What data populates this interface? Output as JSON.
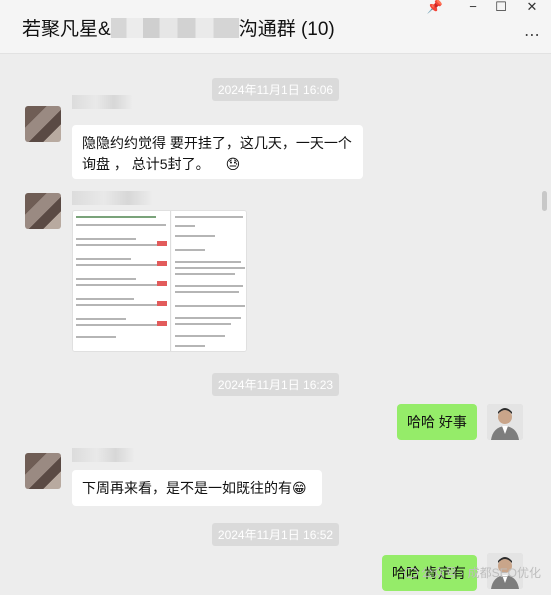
{
  "window": {
    "title_prefix": "若聚凡星&",
    "title_suffix": "沟通群 (10)",
    "pin_icon": "📌",
    "minimize_icon": "−",
    "maximize_icon": "☐",
    "close_icon": "✕",
    "more_icon": "⋯"
  },
  "messages": [
    {
      "timestamp": "2024年11月1日 16:06"
    },
    {
      "sender": "other",
      "text_line1": "隐隐约约觉得 要开挂了，这几天，一天一个",
      "text_line2": "询盘 ， 总计5封了。",
      "emoji": "😓"
    },
    {
      "sender": "other",
      "type": "image"
    },
    {
      "timestamp": "2024年11月1日 16:23"
    },
    {
      "sender": "me",
      "text": "哈哈 好事"
    },
    {
      "sender": "other",
      "text": "下周再来看，是不是一如既往的有😁"
    },
    {
      "timestamp": "2024年11月1日 16:52"
    },
    {
      "sender": "me",
      "text": "哈哈 肯定有"
    }
  ],
  "watermark": "公众号 · 成都SEO优化"
}
